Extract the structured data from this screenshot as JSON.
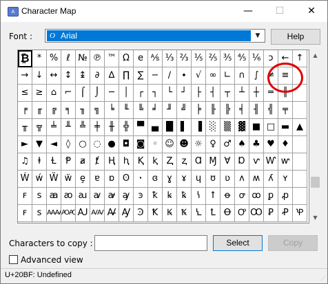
{
  "window": {
    "title": "Character Map",
    "minimize_glyph": "—",
    "maximize_glyph": "☐",
    "close_glyph": "✕"
  },
  "font_row": {
    "label": "Font :",
    "selected_font": "Arial",
    "help_label": "Help"
  },
  "grid": {
    "rows": [
      [
        "₿",
        "*",
        "%",
        "ℓ",
        "№",
        "℗",
        "™",
        "Ω",
        "e",
        "⅍",
        "⅓",
        "⅔",
        "⅕",
        "⅖",
        "⅗",
        "⅘",
        "⅙",
        "ↄ",
        "←",
        "↑"
      ],
      [
        "→",
        "↓",
        "↔",
        "↕",
        "↨",
        "∂",
        "∆",
        "∏",
        "∑",
        "−",
        "∕",
        "∙",
        "√",
        "∞",
        "∟",
        "∩",
        "∫",
        "≠",
        "≡",
        ""
      ],
      [
        "≤",
        "≥",
        "⌂",
        "⌐",
        "⌠",
        "⌡",
        "─",
        "│",
        "┌",
        "┐",
        "└",
        "┘",
        "├",
        "┤",
        "┬",
        "┴",
        "┼",
        "═",
        "║",
        ""
      ],
      [
        "╒",
        "╓",
        "╔",
        "╕",
        "╖",
        "╗",
        "╘",
        "╙",
        "╚",
        "╛",
        "╜",
        "╝",
        "╞",
        "╟",
        "╠",
        "╡",
        "╢",
        "╣",
        "╤",
        ""
      ],
      [
        "╥",
        "╦",
        "╧",
        "╨",
        "╩",
        "╪",
        "╫",
        "╬",
        "▀",
        "▄",
        "█",
        "▌",
        "▐",
        "░",
        "▒",
        "▓",
        "■",
        "□",
        "▬",
        "▲"
      ],
      [
        "►",
        "▼",
        "◄",
        "◊",
        "○",
        "◌",
        "●",
        "◘",
        "◙",
        "◦",
        "☺",
        "☻",
        "☼",
        "♀",
        "♂",
        "♠",
        "♣",
        "♥",
        "♦",
        ""
      ],
      [
        "♫",
        "ⱡ",
        "Ɫ",
        "Ᵽ",
        "ⱥ",
        "ⱦ",
        "Ⱨ",
        "ⱨ",
        "Ⱪ",
        "ⱪ",
        "Ⱬ",
        "ⱬ",
        "Ɑ",
        "Ɱ",
        "Ɐ",
        "Ɒ",
        "ⱱ",
        "Ⱳ",
        "ⱳ",
        ""
      ],
      [
        "Ẃ",
        "ẃ",
        "Ẅ",
        "ẅ",
        "ȩ",
        "ɐ",
        "ɒ",
        "ʘ",
        "ꞏ",
        "ɞ",
        "ɣ",
        "ɤ",
        "ɥ",
        "ʊ",
        "ʋ",
        "ʌ",
        "ʍ",
        "ʎ",
        "ʏ",
        ""
      ],
      [
        "ꜰ",
        "ꜱ",
        "ꜳ",
        "ꜵ",
        "ꜷ",
        "ꜹ",
        "ꜻ",
        "ꜽ",
        "ꜿ",
        "ꝁ",
        "ꝃ",
        "ꝅ",
        "ꝇ",
        "ꝉ",
        "ꝋ",
        "ꝍ",
        "ꝏ",
        "ꝑ",
        "ꝓ",
        ""
      ],
      [
        "ꜰ",
        "ꜱ",
        "ꜲꜲ",
        "ꜴꜴ",
        "Ꜷ",
        "ꜸꜸ",
        "Ꜻ",
        "Ꜽ",
        "Ꜿ",
        "Ꝁ",
        "Ꝃ",
        "Ꝅ",
        "Ꝇ",
        "Ꝉ",
        "Ꝋ",
        "Ꝍ",
        "Ꝏ",
        "Ꝑ",
        "Ꝓ",
        "Ꝕ"
      ]
    ]
  },
  "copy_row": {
    "label": "Characters to copy :",
    "value": "",
    "select_label": "Select",
    "copy_label": "Copy"
  },
  "advanced": {
    "label": "Advanced view",
    "checked": false
  },
  "status": {
    "text": "U+20BF: Undefined"
  },
  "scrollbar": {
    "up_glyph": "▲",
    "down_glyph": "▼"
  }
}
